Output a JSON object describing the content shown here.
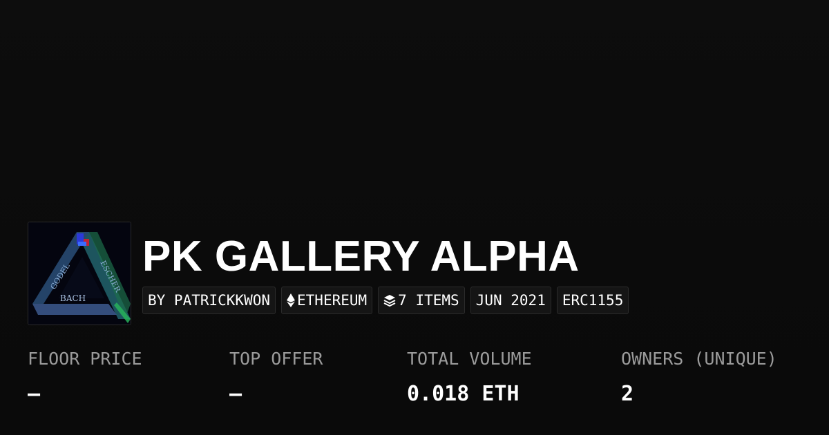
{
  "collection": {
    "title": "PK GALLERY ALPHA",
    "tags": [
      {
        "label": "BY PATRICKKWON",
        "icon": ""
      },
      {
        "label": "ETHEREUM",
        "icon": "ethereum-icon"
      },
      {
        "label": "7 ITEMS",
        "icon": "layers-icon"
      },
      {
        "label": "JUN 2021",
        "icon": ""
      },
      {
        "label": "ERC1155",
        "icon": ""
      }
    ],
    "thumbnail": {
      "name": "collection-thumbnail",
      "art_text": [
        "GODEL",
        "ESCHER",
        "BACH"
      ]
    }
  },
  "stats": [
    {
      "label": "FLOOR PRICE",
      "value": "–"
    },
    {
      "label": "TOP OFFER",
      "value": "–"
    },
    {
      "label": "TOTAL VOLUME",
      "value": "0.018 ETH"
    },
    {
      "label": "OWNERS (UNIQUE)",
      "value": "2"
    }
  ],
  "colors": {
    "background": "#0b0b0b",
    "text": "#ffffff",
    "muted_label": "#9b9b9b",
    "tag_background": "#151515",
    "tag_border": "#2b2b2b"
  }
}
